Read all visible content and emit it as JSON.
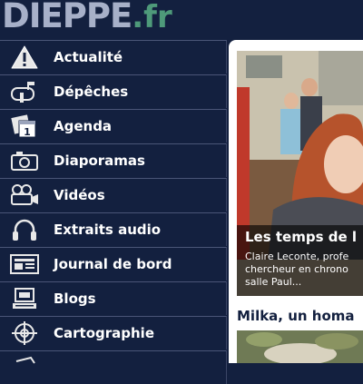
{
  "logo": {
    "name": "DIEPPE",
    "tld": ".fr"
  },
  "sidebar": {
    "items": [
      {
        "label": "Actualité",
        "icon": "warning-icon"
      },
      {
        "label": "Dépêches",
        "icon": "mailbox-icon"
      },
      {
        "label": "Agenda",
        "icon": "calendar-icon"
      },
      {
        "label": "Diaporamas",
        "icon": "camera-icon"
      },
      {
        "label": "Vidéos",
        "icon": "video-camera-icon"
      },
      {
        "label": "Extraits audio",
        "icon": "headphones-icon"
      },
      {
        "label": "Journal de bord",
        "icon": "newspaper-icon"
      },
      {
        "label": "Blogs",
        "icon": "computer-icon"
      },
      {
        "label": "Cartographie",
        "icon": "crosshair-icon"
      }
    ]
  },
  "feature": {
    "title": "Les temps de l",
    "text": "Claire Leconte, profe\nchercheur en chrono\nsalle Paul..."
  },
  "article": {
    "title": "Milka, un homa"
  },
  "colors": {
    "background": "#13203f",
    "logo": "#a7b0c8",
    "logo_tld": "#4e9a7a",
    "divider": "#4a5577"
  }
}
